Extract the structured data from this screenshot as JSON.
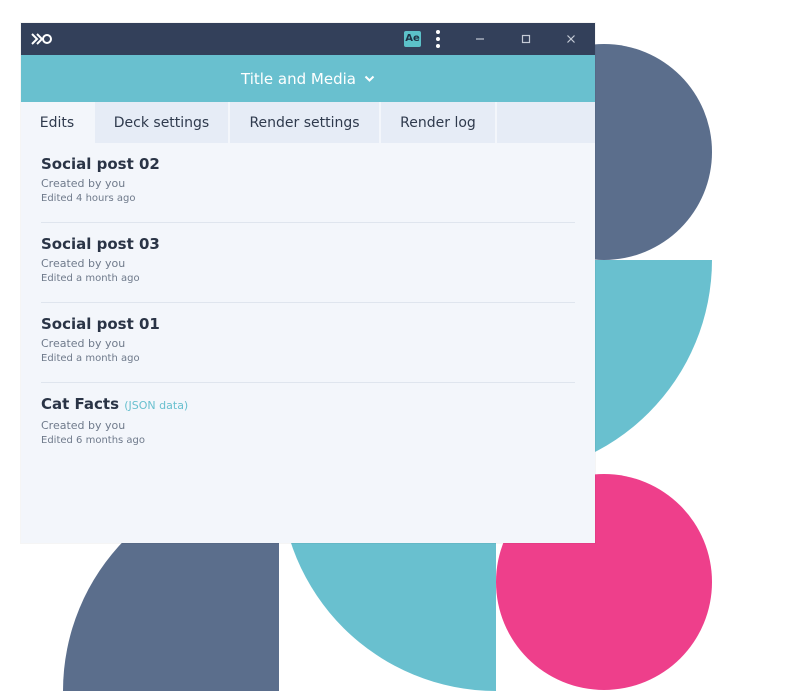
{
  "colors": {
    "slate": "#5b6e8c",
    "teal": "#69c0cf",
    "pink": "#ee3f8b",
    "titlebar": "#33405a"
  },
  "titlebar": {
    "logo_icon": "app-logo-icon",
    "ae_badge": "Ae",
    "menu_icon": "kebab-menu-icon",
    "minimize_icon": "minimize-icon",
    "maximize_icon": "maximize-icon",
    "close_icon": "close-icon"
  },
  "header": {
    "title": "Title and Media",
    "chevron_icon": "chevron-down-icon"
  },
  "tabs": [
    {
      "label": "Edits",
      "active": true
    },
    {
      "label": "Deck settings",
      "active": false
    },
    {
      "label": "Render settings",
      "active": false
    },
    {
      "label": "Render log",
      "active": false
    }
  ],
  "items": [
    {
      "title": "Social post 02",
      "tag": "",
      "created": "Created by you",
      "edited": "Edited 4 hours ago"
    },
    {
      "title": "Social post 03",
      "tag": "",
      "created": "Created by you",
      "edited": "Edited a month ago"
    },
    {
      "title": "Social post 01",
      "tag": "",
      "created": "Created by you",
      "edited": "Edited a month ago"
    },
    {
      "title": "Cat Facts",
      "tag": "(JSON data)",
      "created": "Created by you",
      "edited": "Edited 6 months ago"
    }
  ]
}
